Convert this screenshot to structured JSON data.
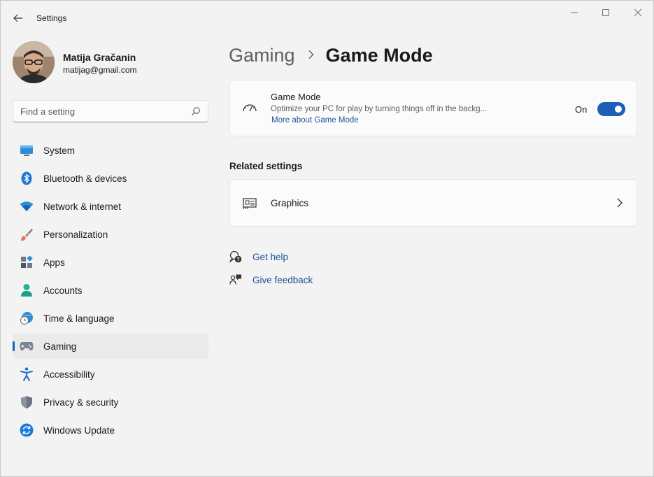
{
  "app": {
    "title": "Settings"
  },
  "window_controls": {
    "minimize_icon": "minimize-icon",
    "maximize_icon": "maximize-icon",
    "close_icon": "close-icon"
  },
  "profile": {
    "name": "Matija Gračanin",
    "email": "matijag@gmail.com"
  },
  "search": {
    "placeholder": "Find a setting",
    "icon": "search-icon"
  },
  "sidebar": {
    "items": [
      {
        "label": "System",
        "icon": "system-icon",
        "selected": false
      },
      {
        "label": "Bluetooth & devices",
        "icon": "bluetooth-icon",
        "selected": false
      },
      {
        "label": "Network & internet",
        "icon": "wifi-icon",
        "selected": false
      },
      {
        "label": "Personalization",
        "icon": "brush-icon",
        "selected": false
      },
      {
        "label": "Apps",
        "icon": "apps-icon",
        "selected": false
      },
      {
        "label": "Accounts",
        "icon": "person-icon",
        "selected": false
      },
      {
        "label": "Time & language",
        "icon": "globe-clock-icon",
        "selected": false
      },
      {
        "label": "Gaming",
        "icon": "gamepad-icon",
        "selected": true
      },
      {
        "label": "Accessibility",
        "icon": "accessibility-icon",
        "selected": false
      },
      {
        "label": "Privacy & security",
        "icon": "shield-icon",
        "selected": false
      },
      {
        "label": "Windows Update",
        "icon": "refresh-icon",
        "selected": false
      }
    ]
  },
  "breadcrumb": {
    "parent": "Gaming",
    "current": "Game Mode"
  },
  "game_mode_card": {
    "title": "Game Mode",
    "description": "Optimize your PC for play by turning things off in the backg...",
    "link": "More about Game Mode",
    "toggle_label": "On",
    "toggle_on": true
  },
  "related": {
    "heading": "Related settings",
    "graphics_label": "Graphics"
  },
  "help": {
    "get_help": "Get help",
    "give_feedback": "Give feedback"
  },
  "colors": {
    "accent": "#1c5fb4",
    "link": "#1c4f9c",
    "background": "#f3f3f3"
  }
}
